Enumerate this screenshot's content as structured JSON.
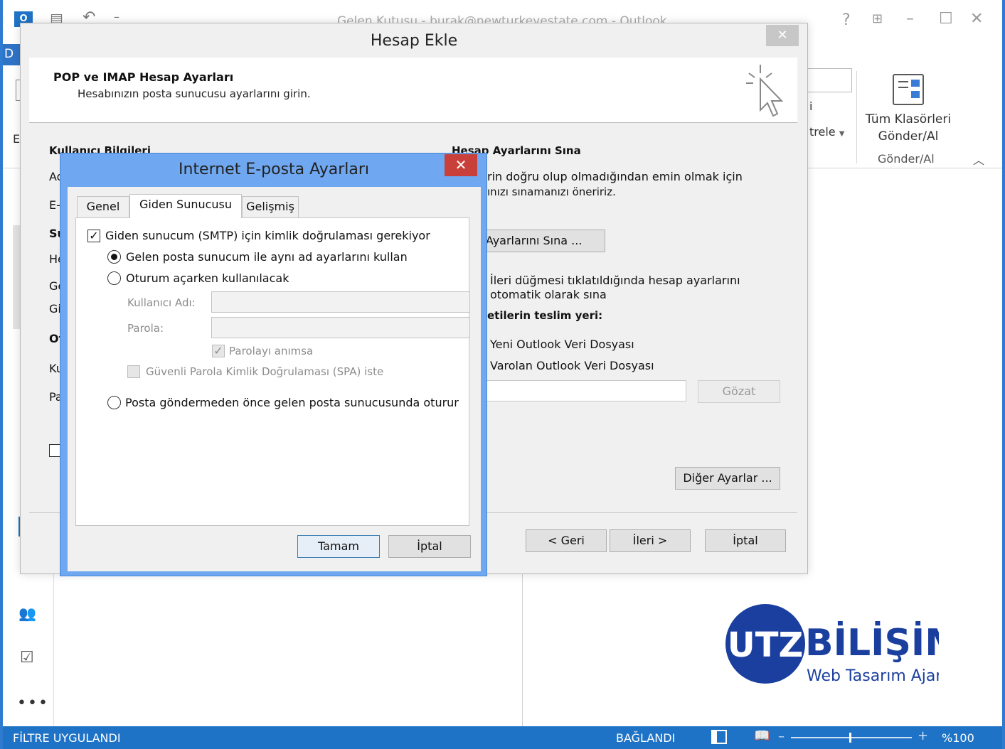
{
  "outlook": {
    "window_title": "Gelen Kutusu - burak@newturkeyestate.com - Outlook",
    "ribbon": {
      "send_receive_all_line1": "Tüm Klasörleri",
      "send_receive_all_line2": "Gönder/Al",
      "group_label": "Gönder/Al",
      "filter_partial": "trele",
      "partial_i": "i"
    },
    "left_partial_e": "E-",
    "tab_partial": "D",
    "status_bar": {
      "filter_status": "FİLTRE UYGULANDI",
      "connection_status": "BAĞLANDI",
      "zoom": "%100"
    }
  },
  "hesap_ekle": {
    "title": "Hesap Ekle",
    "header_title": "POP ve IMAP Hesap Ayarları",
    "header_subtitle": "Hesabınızın posta sunucusu ayarlarını girin.",
    "user_info_heading": "Kullanıcı Bilgileri",
    "test_heading": "Hesap Ayarlarını Sına",
    "test_desc_line1": "rin doğru olup olmadığından emin olmak için",
    "test_desc_line2": "ınızı sınamanızı öneririz.",
    "test_button": "p Ayarlarını Sına ...",
    "auto_test_line1": "İleri düğmesi tıklatıldığında hesap ayarlarını",
    "auto_test_line2": "otomatik olarak sına",
    "deliver_heading": "etilerin teslim yeri:",
    "new_data_file": "Yeni Outlook Veri Dosyası",
    "existing_data_file": "Varolan Outlook Veri Dosyası",
    "browse_button": "Gözat",
    "more_settings_button": "Diğer Ayarlar ...",
    "back_button": "< Geri",
    "next_button": "İleri >",
    "cancel_button": "İptal",
    "left_labels": [
      "Ad",
      "E-",
      "Su",
      "He",
      "Ge",
      "Gi",
      "Ot",
      "Ku",
      "Pa"
    ]
  },
  "internet_settings": {
    "title": "Internet E-posta Ayarları",
    "tabs": [
      "Genel",
      "Giden Sunucusu",
      "Gelişmiş"
    ],
    "smtp_auth_label": "Giden sunucum (SMTP) için kimlik doğrulaması gerekiyor",
    "smtp_auth_checked": true,
    "same_settings_label": "Gelen posta sunucum ile aynı ad ayarlarını kullan",
    "logon_using_label": "Oturum açarken kullanılacak",
    "username_label": "Kullanıcı Adı:",
    "username_value": "",
    "password_label": "Parola:",
    "password_value": "",
    "remember_password_label": "Parolayı anımsa",
    "spa_label": "Güvenli Parola Kimlik Doğrulaması (SPA) iste",
    "logon_before_send_label": "Posta göndermeden önce gelen posta sunucusunda oturur",
    "ok_button": "Tamam",
    "cancel_button": "İptal"
  },
  "logo": {
    "mark": "UTZ",
    "name": "BİLİŞİM",
    "tagline": "Web Tasarım Ajansı",
    "color": "#1a3f9e"
  },
  "colors": {
    "accent": "#1e73c6",
    "dialog_frame": "#6fa8f0",
    "close_red": "#c9403a"
  }
}
